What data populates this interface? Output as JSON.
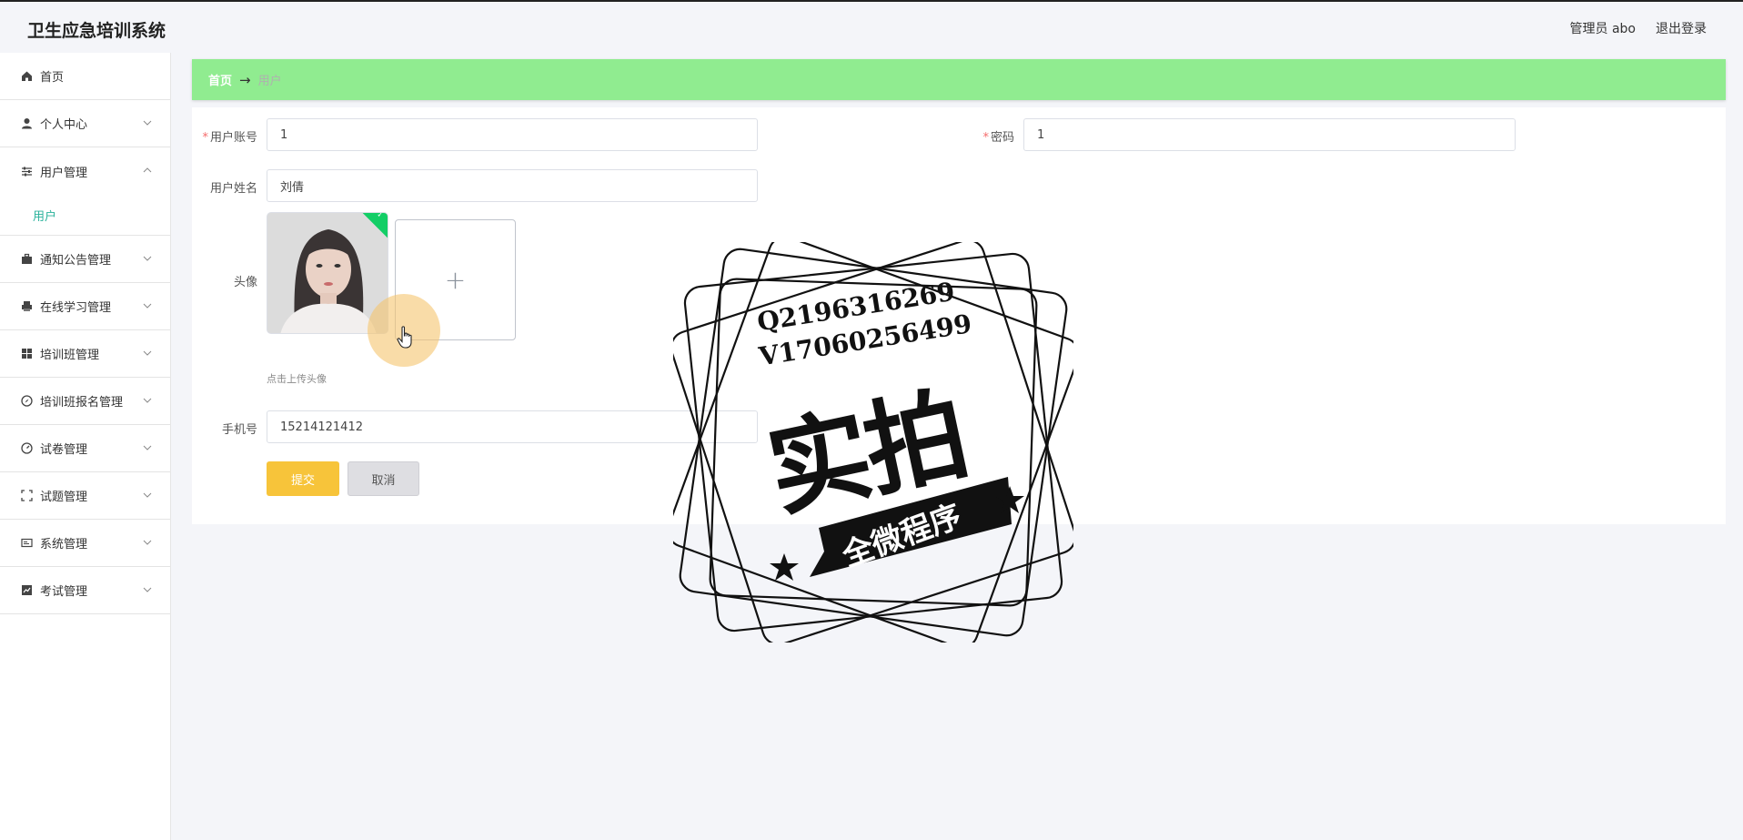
{
  "app": {
    "title": "卫生应急培训系统"
  },
  "header": {
    "user_label": "管理员 abo",
    "logout_label": "退出登录"
  },
  "sidebar": {
    "items": [
      {
        "label": "首页",
        "icon": "home-icon"
      },
      {
        "label": "个人中心",
        "icon": "user-icon"
      },
      {
        "label": "用户管理",
        "icon": "sliders-icon",
        "expanded": true,
        "children": [
          {
            "label": "用户"
          }
        ]
      },
      {
        "label": "通知公告管理",
        "icon": "briefcase-icon"
      },
      {
        "label": "在线学习管理",
        "icon": "printer-icon"
      },
      {
        "label": "培训班管理",
        "icon": "grid-icon"
      },
      {
        "label": "培训班报名管理",
        "icon": "compass-icon"
      },
      {
        "label": "试卷管理",
        "icon": "gauge-icon"
      },
      {
        "label": "试题管理",
        "icon": "frame-icon"
      },
      {
        "label": "系统管理",
        "icon": "card-icon"
      },
      {
        "label": "考试管理",
        "icon": "chart-icon"
      }
    ]
  },
  "breadcrumb": {
    "home": "首页",
    "arrow": "→",
    "current": "用户"
  },
  "form": {
    "account_label": "用户账号",
    "account_value": "1",
    "password_label": "密码",
    "password_value": "1",
    "name_label": "用户姓名",
    "name_value": "刘倩",
    "avatar_label": "头像",
    "avatar_hint": "点击上传头像",
    "upload_symbol": "+",
    "phone_label": "手机号",
    "phone_value": "15214121412",
    "required_mark": "*",
    "submit_label": "提交",
    "cancel_label": "取消"
  },
  "watermark": {
    "line1": "Q2196316269",
    "line2": "V17060256499",
    "big_text": "实拍",
    "band_text": "全微程序"
  },
  "colors": {
    "breadcrumb_bg": "#90ec90",
    "accent": "#2ab29b",
    "submit_bg": "#f7c43a",
    "required": "#f56c6c"
  }
}
